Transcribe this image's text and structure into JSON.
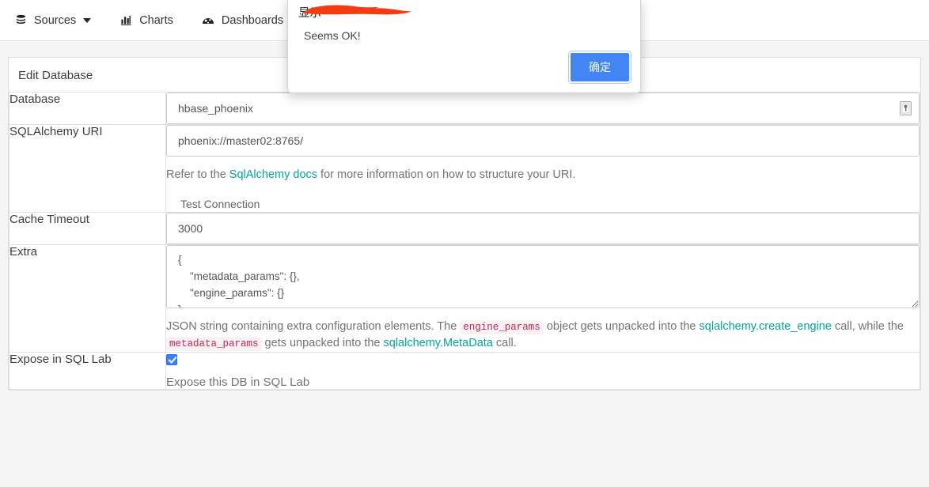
{
  "navbar": {
    "items": [
      {
        "label": "Sources",
        "icon": "database-stack-icon",
        "has_caret": true
      },
      {
        "label": "Charts",
        "icon": "bar-chart-icon",
        "has_caret": false
      },
      {
        "label": "Dashboards",
        "icon": "dashboard-gauge-icon",
        "has_caret": false
      }
    ]
  },
  "page": {
    "title": "Edit Database"
  },
  "form": {
    "database": {
      "label": "Database",
      "value": "hbase_phoenix",
      "placeholder": "",
      "autofill_icon": "password-manager-icon"
    },
    "sqlalchemy_uri": {
      "label": "SQLAlchemy URI",
      "value": "phoenix://master02:8765/",
      "placeholder": "",
      "help_prefix": "Refer to the ",
      "help_link": "SqlAlchemy docs",
      "help_suffix": " for more information on how to structure your URI.",
      "test_connection_label": "Test Connection"
    },
    "cache_timeout": {
      "label": "Cache Timeout",
      "value": "3000",
      "placeholder": ""
    },
    "extra": {
      "label": "Extra",
      "value": "{\n    \"metadata_params\": {},\n    \"engine_params\": {}\n}",
      "help_part1": "JSON string containing extra configuration elements. The ",
      "help_code1": "engine_params",
      "help_part2": " object gets unpacked into the ",
      "help_link1": "sqlalchemy.create_engine",
      "help_part3": " call, while the ",
      "help_code2": "metadata_params",
      "help_part4": " gets unpacked into the ",
      "help_link2": "sqlalchemy.MetaData",
      "help_part5": " call."
    },
    "expose_in_sql_lab": {
      "label": "Expose in SQL Lab",
      "checked": true,
      "help": "Expose this DB in SQL Lab"
    }
  },
  "dialog": {
    "origin_text": "",
    "title_suffix": "显示",
    "message": "Seems OK!",
    "ok_label": "确定",
    "redaction_color": "#f43b12"
  },
  "colors": {
    "link": "#00a699",
    "code_text": "#c7254e",
    "code_bg": "#f9f2f4",
    "primary_button": "#4285f4",
    "checkbox": "#3b82f6",
    "page_bg": "#f5f5f5"
  }
}
